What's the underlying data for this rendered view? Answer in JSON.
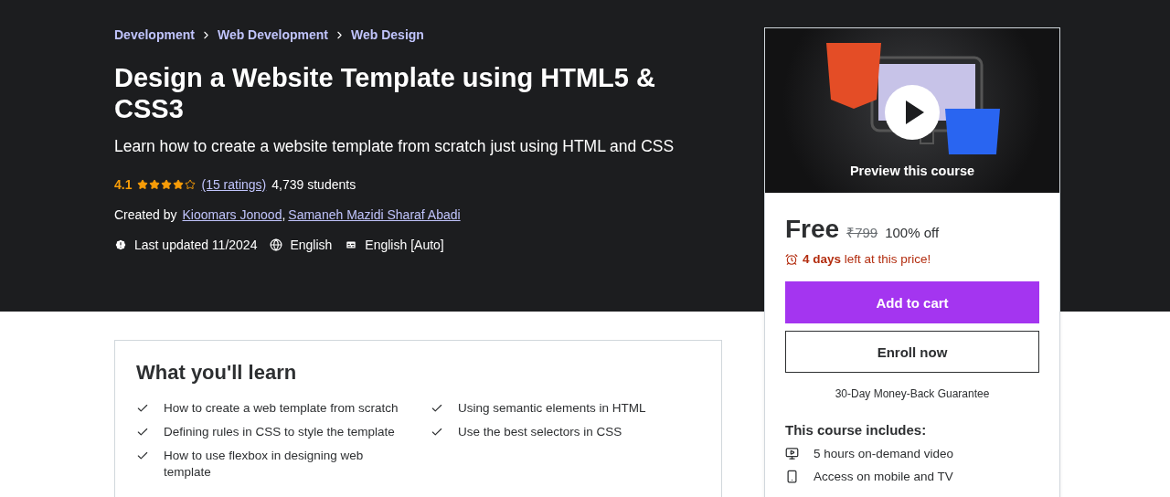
{
  "breadcrumbs": [
    "Development",
    "Web Development",
    "Web Design"
  ],
  "title": "Design a Website Template using HTML5 & CSS3",
  "subtitle": "Learn how to create a website template from scratch just using HTML and CSS",
  "rating": {
    "value": "4.1",
    "stars": 4,
    "ratings_link": "(15 ratings)",
    "students": "4,739 students"
  },
  "created_by": {
    "label": "Created by",
    "authors": [
      {
        "name": "Kioomars Jonood",
        "separator": ","
      },
      {
        "name": "Samaneh Mazidi Sharaf Abadi"
      }
    ]
  },
  "meta": [
    {
      "kind": "updated",
      "text": "Last updated 11/2024"
    },
    {
      "kind": "language",
      "text": "English"
    },
    {
      "kind": "captions",
      "text": "English [Auto]"
    }
  ],
  "learn": {
    "title": "What you'll learn",
    "items": [
      "How to create a web template from scratch",
      "Using semantic elements in HTML",
      "Defining rules in CSS to style the template",
      "Use the best selectors in CSS",
      "How to use flexbox in designing web template"
    ]
  },
  "purchase": {
    "preview_label": "Preview this course",
    "price": "Free",
    "original_price": "₹799",
    "discount": "100% off",
    "timer": "**4 days** left at this price!",
    "add_to_cart": "Add to cart",
    "enroll": "Enroll now",
    "guarantee": "30-Day Money-Back Guarantee",
    "includes_title": "This course includes:",
    "includes": [
      {
        "kind": "video",
        "text": "5 hours on-demand video"
      },
      {
        "kind": "mobile",
        "text": "Access on mobile and TV"
      }
    ]
  }
}
